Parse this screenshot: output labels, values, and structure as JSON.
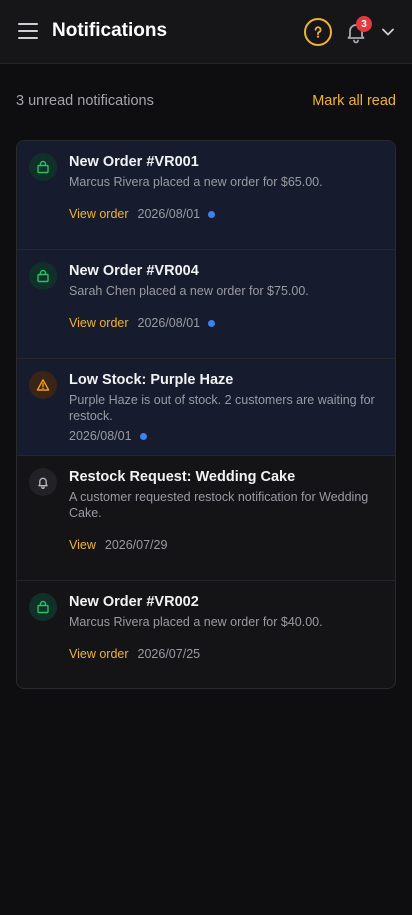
{
  "header": {
    "title": "Notifications",
    "notification_count": "3",
    "accent_color": "#f0b429",
    "badge_color": "#e5393f"
  },
  "summary": {
    "unread_text": "3 unread notifications",
    "mark_all_label": "Mark all read"
  },
  "notifications": [
    {
      "icon": "bag-icon",
      "title": "New Order #VR001",
      "description": "Marcus Rivera placed a new order for $65.00.",
      "action_label": "View order",
      "date": "2026/08/01",
      "unread": true
    },
    {
      "icon": "bag-icon",
      "title": "New Order #VR004",
      "description": "Sarah Chen placed a new order for $75.00.",
      "action_label": "View order",
      "date": "2026/08/01",
      "unread": true
    },
    {
      "icon": "warning-icon",
      "title": "Low Stock: Purple Haze",
      "description": "Purple Haze is out of stock. 2 customers are waiting for restock.",
      "action_label": "",
      "date": "2026/08/01",
      "unread": true
    },
    {
      "icon": "bell-icon",
      "title": "Restock Request: Wedding Cake",
      "description": "A customer requested restock notification for Wedding Cake.",
      "action_label": "View",
      "date": "2026/07/29",
      "unread": false
    },
    {
      "icon": "bag-icon",
      "title": "New Order #VR002",
      "description": "Marcus Rivera placed a new order for $40.00.",
      "action_label": "View order",
      "date": "2026/07/25",
      "unread": false
    }
  ]
}
